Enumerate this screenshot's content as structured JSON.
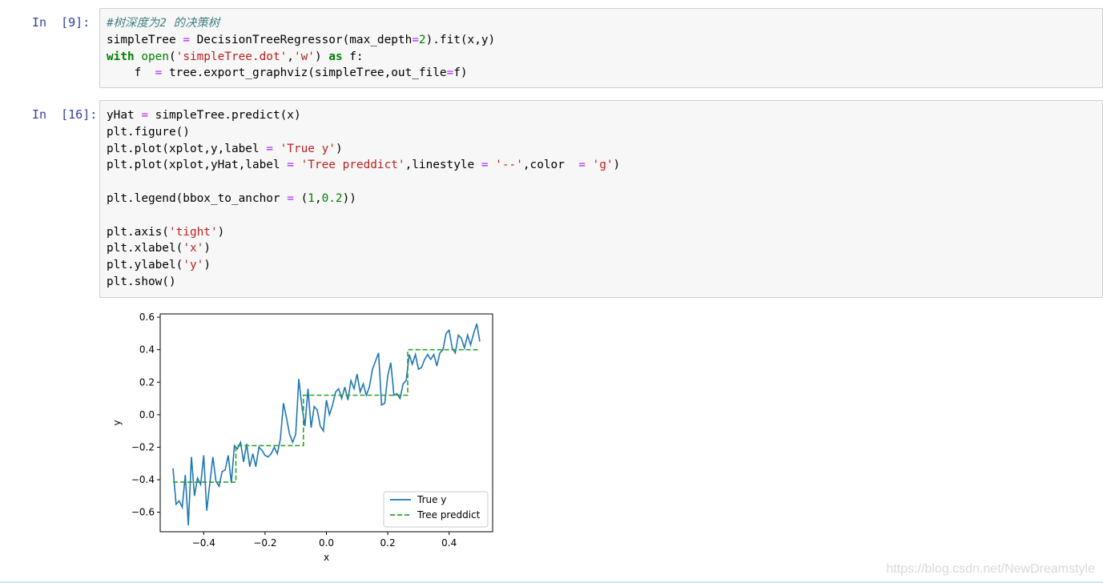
{
  "cells": [
    {
      "prompt": "In  [9]:",
      "lines": [
        [
          {
            "t": "#树深度为2 的决策树",
            "c": "cm"
          }
        ],
        [
          {
            "t": "simpleTree "
          },
          {
            "t": "=",
            "c": "op"
          },
          {
            "t": " DecisionTreeRegressor(max_depth"
          },
          {
            "t": "=",
            "c": "op"
          },
          {
            "t": "2",
            "c": "nu"
          },
          {
            "t": ").fit(x,y)"
          }
        ],
        [
          {
            "t": "with",
            "c": "kw"
          },
          {
            "t": " "
          },
          {
            "t": "open",
            "c": "bi"
          },
          {
            "t": "("
          },
          {
            "t": "'simpleTree.dot'",
            "c": "st"
          },
          {
            "t": ","
          },
          {
            "t": "'w'",
            "c": "st"
          },
          {
            "t": ") "
          },
          {
            "t": "as",
            "c": "kw"
          },
          {
            "t": " f:"
          }
        ],
        [
          {
            "t": "    f  "
          },
          {
            "t": "=",
            "c": "op"
          },
          {
            "t": " tree.export_graphviz(simpleTree,out_file"
          },
          {
            "t": "=",
            "c": "op"
          },
          {
            "t": "f)"
          }
        ]
      ]
    },
    {
      "prompt": "In  [16]:",
      "lines": [
        [
          {
            "t": "yHat "
          },
          {
            "t": "=",
            "c": "op"
          },
          {
            "t": " simpleTree.predict(x)"
          }
        ],
        [
          {
            "t": "plt.figure()"
          }
        ],
        [
          {
            "t": "plt.plot(xplot,y,label "
          },
          {
            "t": "=",
            "c": "op"
          },
          {
            "t": " "
          },
          {
            "t": "'True y'",
            "c": "st"
          },
          {
            "t": ")"
          }
        ],
        [
          {
            "t": "plt.plot(xplot,yHat,label "
          },
          {
            "t": "=",
            "c": "op"
          },
          {
            "t": " "
          },
          {
            "t": "'Tree preddict'",
            "c": "st"
          },
          {
            "t": ",linestyle "
          },
          {
            "t": "=",
            "c": "op"
          },
          {
            "t": " "
          },
          {
            "t": "'--'",
            "c": "st"
          },
          {
            "t": ",color  "
          },
          {
            "t": "=",
            "c": "op"
          },
          {
            "t": " "
          },
          {
            "t": "'g'",
            "c": "st"
          },
          {
            "t": ")"
          }
        ],
        [
          {
            "t": ""
          }
        ],
        [
          {
            "t": "plt.legend(bbox_to_anchor "
          },
          {
            "t": "=",
            "c": "op"
          },
          {
            "t": " ("
          },
          {
            "t": "1",
            "c": "nu"
          },
          {
            "t": ","
          },
          {
            "t": "0.2",
            "c": "nu"
          },
          {
            "t": "))"
          }
        ],
        [
          {
            "t": ""
          }
        ],
        [
          {
            "t": "plt.axis("
          },
          {
            "t": "'tight'",
            "c": "st"
          },
          {
            "t": ")"
          }
        ],
        [
          {
            "t": "plt.xlabel("
          },
          {
            "t": "'x'",
            "c": "st"
          },
          {
            "t": ")"
          }
        ],
        [
          {
            "t": "plt.ylabel("
          },
          {
            "t": "'y'",
            "c": "st"
          },
          {
            "t": ")"
          }
        ],
        [
          {
            "t": "plt.show()"
          }
        ]
      ]
    }
  ],
  "watermark": "https://blog.csdn.net/NewDreamstyle",
  "chart_data": {
    "type": "line",
    "xlabel": "x",
    "ylabel": "y",
    "xlim": [
      -0.5,
      0.5
    ],
    "ylim": [
      -0.72,
      0.62
    ],
    "xticks": [
      -0.4,
      -0.2,
      0.0,
      0.2,
      0.4
    ],
    "xtick_labels": [
      "−0.4",
      "−0.2",
      "0.0",
      "0.2",
      "0.4"
    ],
    "yticks": [
      -0.6,
      -0.4,
      -0.2,
      0.0,
      0.2,
      0.4,
      0.6
    ],
    "ytick_labels": [
      "−0.6",
      "−0.4",
      "−0.2",
      "0.0",
      "0.2",
      "0.4",
      "0.6"
    ],
    "legend_position": "bottom-right",
    "series": [
      {
        "name": "True y",
        "color": "#1f77b4",
        "linestyle": "solid",
        "x": [
          -0.5,
          -0.49,
          -0.48,
          -0.47,
          -0.46,
          -0.45,
          -0.44,
          -0.43,
          -0.42,
          -0.41,
          -0.4,
          -0.39,
          -0.38,
          -0.37,
          -0.36,
          -0.35,
          -0.34,
          -0.33,
          -0.32,
          -0.31,
          -0.3,
          -0.29,
          -0.28,
          -0.27,
          -0.26,
          -0.25,
          -0.24,
          -0.23,
          -0.22,
          -0.21,
          -0.2,
          -0.19,
          -0.18,
          -0.17,
          -0.16,
          -0.15,
          -0.14,
          -0.13,
          -0.12,
          -0.11,
          -0.1,
          -0.09,
          -0.08,
          -0.07,
          -0.06,
          -0.05,
          -0.04,
          -0.03,
          -0.02,
          -0.01,
          0.0,
          0.01,
          0.02,
          0.03,
          0.04,
          0.05,
          0.06,
          0.07,
          0.08,
          0.09,
          0.1,
          0.11,
          0.12,
          0.13,
          0.14,
          0.15,
          0.16,
          0.17,
          0.18,
          0.19,
          0.2,
          0.21,
          0.22,
          0.23,
          0.24,
          0.25,
          0.26,
          0.27,
          0.28,
          0.29,
          0.3,
          0.31,
          0.32,
          0.33,
          0.34,
          0.35,
          0.36,
          0.37,
          0.38,
          0.39,
          0.4,
          0.41,
          0.42,
          0.43,
          0.44,
          0.45,
          0.46,
          0.47,
          0.48,
          0.49,
          0.5
        ],
        "y": [
          -0.33,
          -0.55,
          -0.53,
          -0.57,
          -0.37,
          -0.68,
          -0.26,
          -0.5,
          -0.39,
          -0.43,
          -0.25,
          -0.59,
          -0.42,
          -0.26,
          -0.41,
          -0.44,
          -0.35,
          -0.34,
          -0.25,
          -0.42,
          -0.19,
          -0.21,
          -0.17,
          -0.29,
          -0.18,
          -0.32,
          -0.24,
          -0.32,
          -0.2,
          -0.22,
          -0.25,
          -0.26,
          -0.24,
          -0.2,
          -0.24,
          -0.15,
          0.07,
          -0.02,
          -0.12,
          -0.17,
          -0.12,
          0.22,
          0.05,
          -0.07,
          0.16,
          -0.08,
          0.05,
          0.03,
          -0.07,
          -0.1,
          0.09,
          0.0,
          0.06,
          0.14,
          0.16,
          0.1,
          0.17,
          0.09,
          0.21,
          0.16,
          0.25,
          0.14,
          0.19,
          0.12,
          0.17,
          0.28,
          0.33,
          0.38,
          0.06,
          0.07,
          0.24,
          0.32,
          0.12,
          0.13,
          0.1,
          0.19,
          0.21,
          0.37,
          0.31,
          0.37,
          0.28,
          0.29,
          0.34,
          0.37,
          0.34,
          0.37,
          0.3,
          0.38,
          0.4,
          0.5,
          0.52,
          0.41,
          0.38,
          0.49,
          0.47,
          0.41,
          0.49,
          0.43,
          0.5,
          0.56,
          0.45
        ]
      },
      {
        "name": "Tree preddict",
        "color": "#2ca02c",
        "linestyle": "dashed",
        "x": [
          -0.5,
          -0.295,
          -0.295,
          -0.075,
          -0.075,
          0.265,
          0.265,
          0.5
        ],
        "y": [
          -0.415,
          -0.415,
          -0.19,
          -0.19,
          0.12,
          0.12,
          0.4,
          0.4
        ]
      }
    ]
  }
}
